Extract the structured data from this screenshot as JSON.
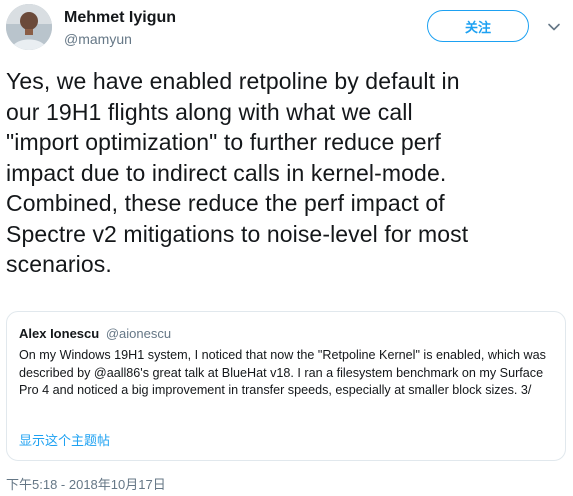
{
  "author": {
    "name": "Mehmet Iyigun",
    "handle": "@mamyun"
  },
  "follow_button": {
    "label": "关注"
  },
  "tweet": {
    "text": "Yes, we have enabled retpoline by default in\nour 19H1 flights along with what we call\n\"import optimization\" to further reduce perf\nimpact due to indirect calls in kernel-mode.\nCombined, these reduce the perf impact of\nSpectre v2 mitigations to noise-level for most\nscenarios."
  },
  "quoted_tweet": {
    "name": "Alex Ionescu",
    "handle": "@aionescu",
    "text": "On my Windows 19H1 system, I noticed that now the \"Retpoline Kernel\" is enabled, which was described by @aall86's great talk at BlueHat v18. I ran a filesystem benchmark on my Surface Pro 4 and noticed a big improvement in transfer speeds, especially at smaller block sizes. 3/",
    "show_thread_label": "显示这个主题帖"
  },
  "timestamp": "下午5:18 - 2018年10月17日",
  "colors": {
    "accent": "#1da1f2",
    "secondary_text": "#657786",
    "border": "#e1e8ed"
  },
  "icons": {
    "menu": "chevron-down-icon"
  }
}
